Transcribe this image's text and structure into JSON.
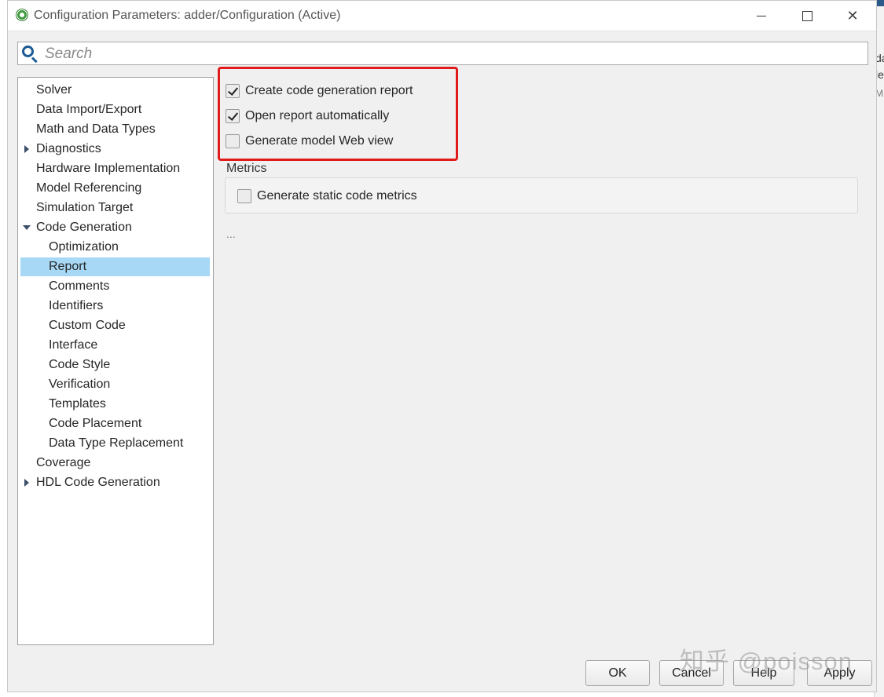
{
  "window": {
    "title": "Configuration Parameters: adder/Configuration (Active)"
  },
  "search": {
    "placeholder": "Search"
  },
  "tree": [
    {
      "label": "Solver",
      "level": 0,
      "arrow": "none"
    },
    {
      "label": "Data Import/Export",
      "level": 0,
      "arrow": "none"
    },
    {
      "label": "Math and Data Types",
      "level": 0,
      "arrow": "none"
    },
    {
      "label": "Diagnostics",
      "level": 0,
      "arrow": "collapsed"
    },
    {
      "label": "Hardware Implementation",
      "level": 0,
      "arrow": "none"
    },
    {
      "label": "Model Referencing",
      "level": 0,
      "arrow": "none"
    },
    {
      "label": "Simulation Target",
      "level": 0,
      "arrow": "none"
    },
    {
      "label": "Code Generation",
      "level": 0,
      "arrow": "expanded"
    },
    {
      "label": "Optimization",
      "level": 1,
      "arrow": "none"
    },
    {
      "label": "Report",
      "level": 1,
      "arrow": "none",
      "selected": true
    },
    {
      "label": "Comments",
      "level": 1,
      "arrow": "none"
    },
    {
      "label": "Identifiers",
      "level": 1,
      "arrow": "none"
    },
    {
      "label": "Custom Code",
      "level": 1,
      "arrow": "none"
    },
    {
      "label": "Interface",
      "level": 1,
      "arrow": "none"
    },
    {
      "label": "Code Style",
      "level": 1,
      "arrow": "none"
    },
    {
      "label": "Verification",
      "level": 1,
      "arrow": "none"
    },
    {
      "label": "Templates",
      "level": 1,
      "arrow": "none"
    },
    {
      "label": "Code Placement",
      "level": 1,
      "arrow": "none"
    },
    {
      "label": "Data Type Replacement",
      "level": 1,
      "arrow": "none"
    },
    {
      "label": "Coverage",
      "level": 0,
      "arrow": "none"
    },
    {
      "label": "HDL Code Generation",
      "level": 0,
      "arrow": "collapsed"
    }
  ],
  "report": {
    "options": [
      {
        "label": "Create code generation report",
        "checked": true
      },
      {
        "label": "Open report automatically",
        "checked": true
      },
      {
        "label": "Generate model Web view",
        "checked": false
      }
    ],
    "metrics": {
      "title": "Metrics",
      "option": {
        "label": "Generate static code metrics",
        "checked": false
      }
    },
    "more": "..."
  },
  "buttons": {
    "ok": "OK",
    "cancel": "Cancel",
    "help": "Help",
    "apply": "Apply"
  },
  "watermark": "知乎 @poisson",
  "background_window": {
    "glyphs": [
      "da",
      "le",
      "MF"
    ]
  },
  "colors": {
    "selection": "#a7d8f5",
    "highlight_box": "#e11b1b",
    "search_icon": "#1c5b95"
  }
}
